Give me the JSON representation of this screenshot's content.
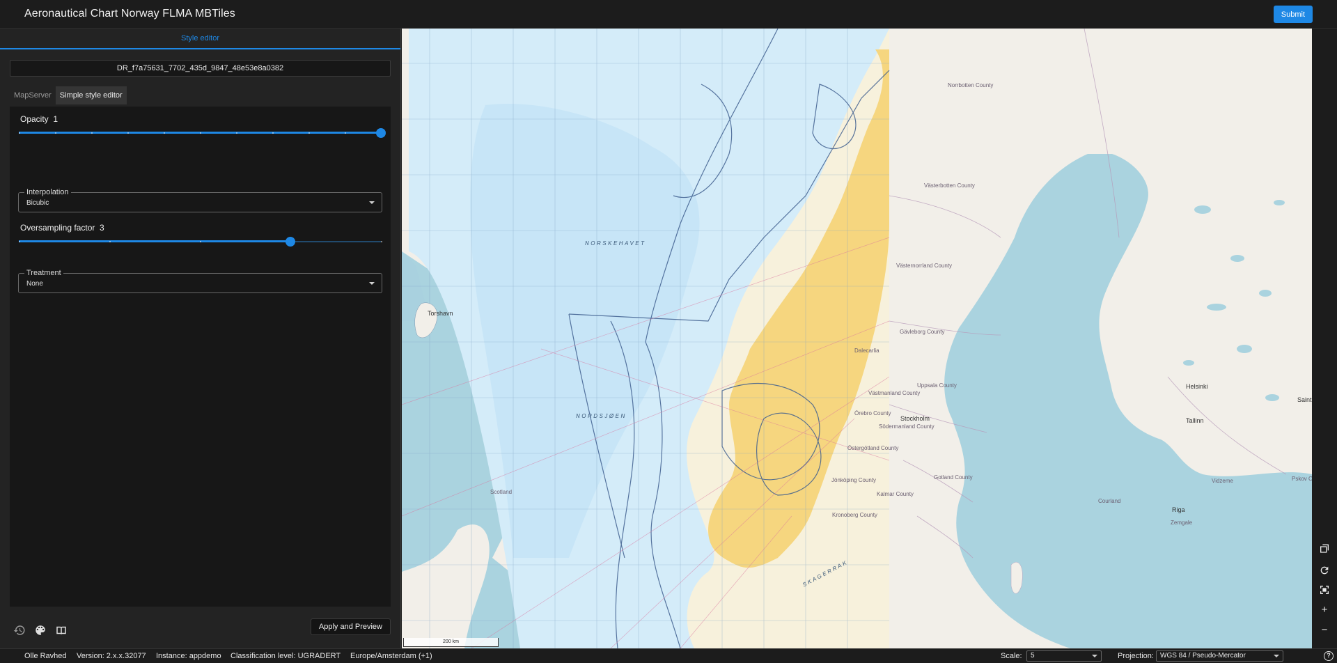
{
  "header": {
    "title": "Aeronautical Chart Norway FLMA MBTiles",
    "submit_label": "Submit"
  },
  "panel": {
    "tab_label": "Style editor",
    "layer_id": "DR_f7a75631_7702_435d_9847_48e53e8a0382",
    "subtabs": [
      {
        "label": "MapServer",
        "active": false
      },
      {
        "label": "Simple style editor",
        "active": true
      }
    ],
    "opacity": {
      "label": "Opacity",
      "value": "1",
      "fraction": 1.0
    },
    "interpolation": {
      "label": "Interpolation",
      "value": "Bicubic"
    },
    "oversampling": {
      "label": "Oversampling factor",
      "value": "3",
      "fraction": 0.75
    },
    "treatment": {
      "label": "Treatment",
      "value": "None"
    },
    "footer": {
      "icons": [
        "history-icon",
        "palette-icon",
        "book-icon"
      ],
      "apply_label": "Apply and Preview"
    }
  },
  "map": {
    "sea_labels": [
      "NORSKEHAVET",
      "NORDSJØEN",
      "SKAGERRAK"
    ],
    "place_labels": [
      "Torshavn",
      "Norrbotten County",
      "Västerbotten County",
      "Västernorrland County",
      "Gävleborg County",
      "Dalecarlia",
      "Uppsala County",
      "Örebro County",
      "Västmanland County",
      "Stockholm",
      "Södermanland County",
      "Östergötland County",
      "Jönköping County",
      "Kalmar County",
      "Kronoberg County",
      "Gotland County",
      "Scotland",
      "Helsinki",
      "Tallinn",
      "Riga",
      "Courland",
      "Vidzeme",
      "Zemgale",
      "Saint",
      "Pskov Oblast"
    ],
    "scale_bar": "200 km",
    "colors": {
      "sea": "#aad3df",
      "land": "#f2efe9",
      "chart_sea": "#d4ecf9",
      "chart_land": "#f6d67f",
      "airspace": "#3f5f8f"
    }
  },
  "toolbar": {
    "icons": [
      "layers-icon",
      "refresh-icon",
      "fit-extent-icon",
      "zoom-in-icon",
      "zoom-out-icon"
    ],
    "zoom_in": "+",
    "zoom_out": "−"
  },
  "status": {
    "user": "Olle Ravhed",
    "version": "Version: 2.x.x.32077",
    "instance": "Instance: appdemo",
    "classification": "Classification level: UGRADERT",
    "timezone": "Europe/Amsterdam (+1)",
    "scale_label": "Scale:",
    "scale_value": "5",
    "projection_label": "Projection:",
    "projection_value": "WGS 84 / Pseudo-Mercator",
    "help": "?"
  }
}
